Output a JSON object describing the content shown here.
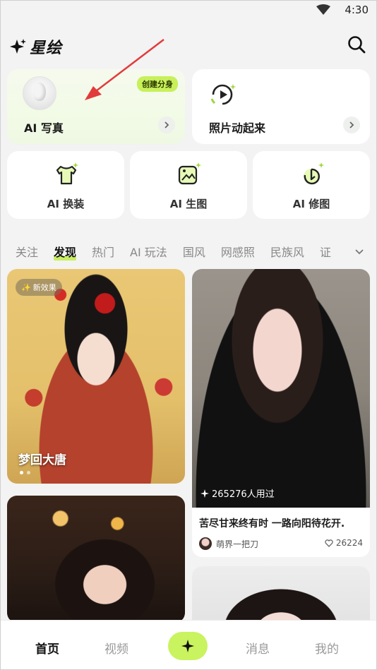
{
  "status_bar": {
    "time": "4:30"
  },
  "header": {
    "app_title": "星绘"
  },
  "features": {
    "ai_photo": {
      "label": "AI 写真",
      "badge": "创建分身"
    },
    "animate": {
      "label": "照片动起来"
    },
    "small": [
      {
        "label": "AI 换装",
        "icon": "shirt-icon"
      },
      {
        "label": "AI 生图",
        "icon": "image-icon"
      },
      {
        "label": "AI 修图",
        "icon": "retouch-icon"
      }
    ]
  },
  "tabs": [
    "关注",
    "发现",
    "热门",
    "AI 玩法",
    "国风",
    "网感照",
    "民族风",
    "证"
  ],
  "active_tab_index": 1,
  "feed": {
    "post1": {
      "tag": "新效果",
      "title": "梦回大唐"
    },
    "post2": {
      "used": "265276人用过",
      "caption": "苦尽甘来终有时 一路向阳待花开.",
      "author": "萌界一把刀",
      "likes": "26224"
    }
  },
  "bottom_nav": [
    "首页",
    "视频",
    "消息",
    "我的"
  ],
  "colors": {
    "accent": "#c9f35f",
    "background": "#f2f3f2"
  }
}
